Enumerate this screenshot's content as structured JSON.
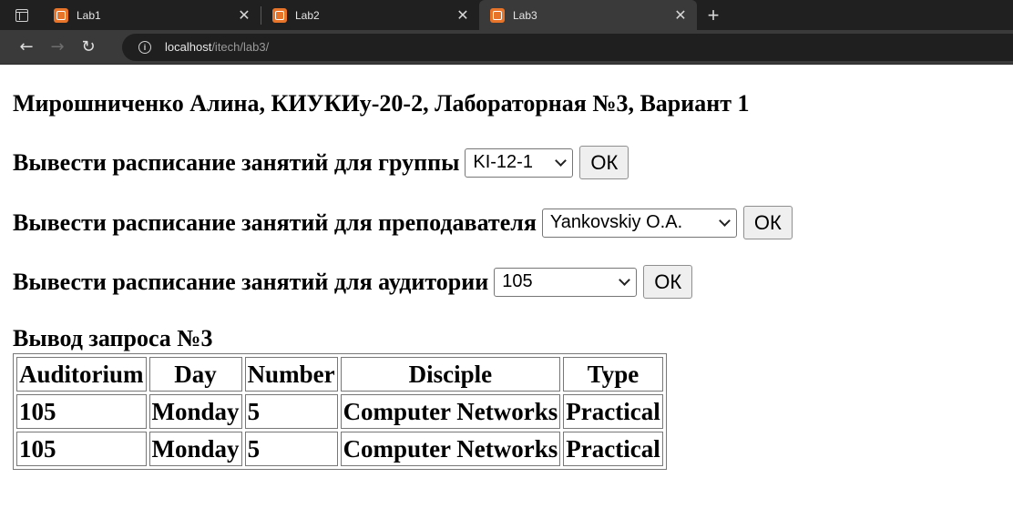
{
  "browser": {
    "tabs": [
      {
        "title": "Lab1",
        "close": "✕"
      },
      {
        "title": "Lab2",
        "close": "✕"
      },
      {
        "title": "Lab3",
        "close": "✕"
      }
    ],
    "new_tab": "+",
    "nav": {
      "back": "←",
      "forward": "→",
      "reload": "↻"
    },
    "url": {
      "host": "localhost",
      "path": "/itech/lab3/"
    },
    "info_icon": "i",
    "icons": [
      "tab-actions-icon",
      "xampp-favicon",
      "close-icon",
      "plus-icon",
      "back-arrow-icon",
      "forward-arrow-icon",
      "reload-icon",
      "info-icon",
      "chevron-down-icon"
    ]
  },
  "page": {
    "title": "Мирошниченко Алина, КИУКИу-20-2, Лабораторная №3, Вариант 1",
    "forms": [
      {
        "label": "Вывести расписание занятий для группы",
        "selected": "KI-12-1",
        "button": "ОК"
      },
      {
        "label": "Вывести расписание занятий для преподавателя",
        "selected": "Yankovskiy O.A.",
        "button": "ОК"
      },
      {
        "label": "Вывести расписание занятий для аудитории",
        "selected": "105",
        "button": "ОК"
      }
    ],
    "result_heading": "Вывод запроса №3",
    "table": {
      "headers": [
        "Auditorium",
        "Day",
        "Number",
        "Disciple",
        "Type"
      ],
      "rows": [
        [
          "105",
          "Monday",
          "5",
          "Computer Networks",
          "Practical"
        ],
        [
          "105",
          "Monday",
          "5",
          "Computer Networks",
          "Practical"
        ]
      ]
    }
  }
}
